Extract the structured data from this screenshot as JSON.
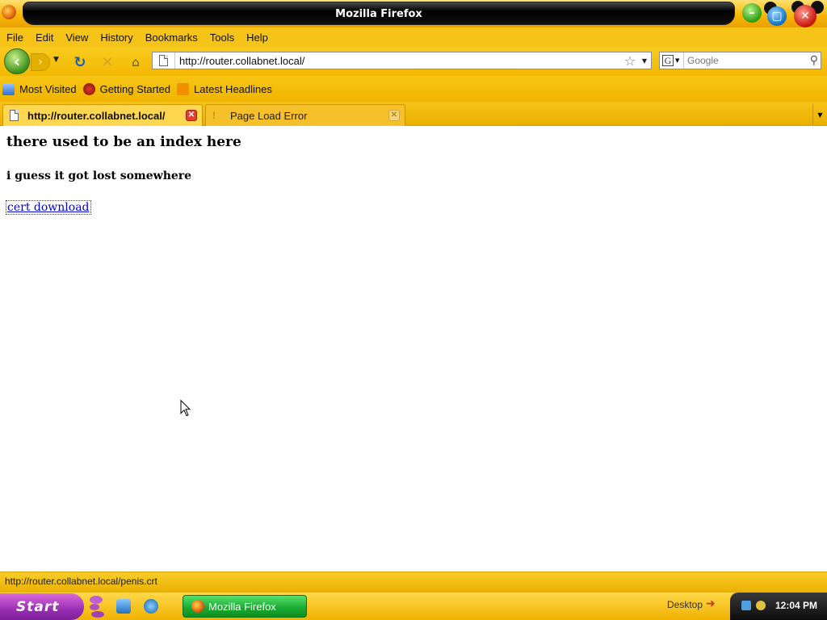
{
  "window": {
    "title": "Mozilla Firefox"
  },
  "menu": {
    "items": [
      {
        "label": "File"
      },
      {
        "label": "Edit"
      },
      {
        "label": "View"
      },
      {
        "label": "History"
      },
      {
        "label": "Bookmarks"
      },
      {
        "label": "Tools"
      },
      {
        "label": "Help"
      }
    ]
  },
  "navigation": {
    "url": "http://router.collabnet.local/",
    "search_placeholder": "Google"
  },
  "bookmarks": {
    "items": [
      {
        "label": "Most Visited"
      },
      {
        "label": "Getting Started"
      },
      {
        "label": "Latest Headlines"
      }
    ]
  },
  "tabs": [
    {
      "label": "http://router.collabnet.local/",
      "active": true
    },
    {
      "label": "Page Load Error",
      "active": false
    }
  ],
  "page": {
    "heading": "there used to be an index here",
    "subheading": "i guess it got lost somewhere",
    "link_text": "cert download"
  },
  "status": {
    "text": "http://router.collabnet.local/penis.crt"
  },
  "taskbar": {
    "start_label": "Start",
    "task_label": "Mozilla Firefox",
    "desktop_label": "Desktop",
    "clock": "12:04 PM"
  },
  "colors": {
    "chrome_yellow": "#f6c318",
    "link_blue": "#0000cc",
    "start_purple": "#9a2fb5",
    "task_green": "#18a830"
  }
}
